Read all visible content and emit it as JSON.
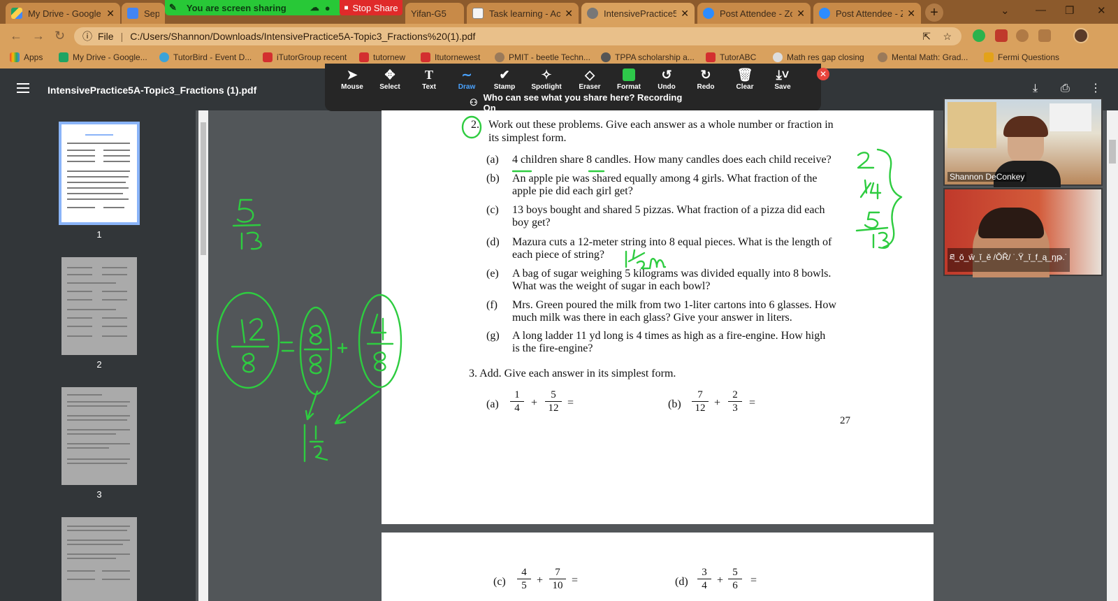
{
  "browser": {
    "tabs": [
      {
        "title": "My Drive - Google",
        "favicon": "drive-icon"
      },
      {
        "title": "Sept",
        "favicon": "docs-icon"
      },
      {
        "title": "Yifan-G5",
        "favicon": "docs-icon"
      },
      {
        "title": "Task learning - Aca",
        "favicon": "page-icon"
      },
      {
        "title": "IntensivePractice5",
        "favicon": "globe-icon"
      },
      {
        "title": "Post Attendee - Zo",
        "favicon": "zoom-icon"
      },
      {
        "title": "Post Attendee - Zo",
        "favicon": "zoom-icon"
      }
    ],
    "address": "C:/Users/Shannon/Downloads/IntensivePractice5A-Topic3_Fractions%20(1).pdf",
    "address_prefix": "File",
    "bookmarks": [
      "Apps",
      "My Drive - Google...",
      "TutorBird - Event D...",
      "iTutorGroup recent",
      "tutornew",
      "Itutornewest",
      "PMIT - beetle Techn...",
      "TPPA scholarship a...",
      "TutorABC",
      "Math res gap closing",
      "Mental Math: Grad...",
      "Fermi Questions"
    ]
  },
  "zoom": {
    "sharing_text": "You are screen sharing",
    "stop_share": "Stop Share",
    "tools": [
      "Mouse",
      "Select",
      "Text",
      "Draw",
      "Stamp",
      "Spotlight",
      "Eraser",
      "Format",
      "Undo",
      "Redo",
      "Clear",
      "Save"
    ],
    "recording_text": "Who can see what you share here? Recording On",
    "participants": [
      "Shannon DeConkey",
      "ཐ_ǒ_ŵ_ĭ_ě /ŎŘ/ ˙.Ÿ_ĭ_f_ą_ŋթ.˙"
    ]
  },
  "pdf": {
    "title": "IntensivePractice5A-Topic3_Fractions (1).pdf",
    "thumbnail_pages": [
      "1",
      "2",
      "3"
    ],
    "q2_number": "2.",
    "q2_intro_1": "Work out these problems.  Give each answer as a whole number or fraction in",
    "q2_intro_2": "its simplest form.",
    "q2_items": [
      {
        "label": "(a)",
        "lines": [
          "4 children share 8 candles. How many candles does each child receive?"
        ]
      },
      {
        "label": "(b)",
        "lines": [
          "An apple pie was shared equally among 4 girls. What fraction of the",
          "apple pie did each girl get?"
        ]
      },
      {
        "label": "(c)",
        "lines": [
          "13 boys bought and shared 5 pizzas. What fraction of a pizza did each",
          "boy get?"
        ]
      },
      {
        "label": "(d)",
        "lines": [
          "Mazura cuts a 12-meter string into 8 equal pieces. What is the length of",
          "each piece of string?"
        ]
      },
      {
        "label": "(e)",
        "lines": [
          "A bag of sugar weighing 5 kilograms was divided equally into 8 bowls.",
          "What was the weight of sugar in each bowl?"
        ]
      },
      {
        "label": "(f)",
        "lines": [
          "Mrs. Green poured the milk from two 1-liter cartons into 6 glasses. How",
          "much milk was there in each glass? Give your answer in liters."
        ]
      },
      {
        "label": "(g)",
        "lines": [
          "A long ladder 11 yd long is 4 times as high as a fire-engine. How high",
          "is the fire-engine?"
        ]
      }
    ],
    "q3_text": "3.  Add. Give each answer in its simplest form.",
    "q3_a": {
      "label": "(a)",
      "f1": [
        "1",
        "4"
      ],
      "f2": [
        "5",
        "12"
      ]
    },
    "q3_b": {
      "label": "(b)",
      "f1": [
        "7",
        "12"
      ],
      "f2": [
        "2",
        "3"
      ]
    },
    "page_number": "27",
    "q3_c": {
      "label": "(c)",
      "f1": [
        "4",
        "5"
      ],
      "f2": [
        "7",
        "10"
      ]
    },
    "q3_d": {
      "label": "(d)",
      "f1": [
        "3",
        "4"
      ],
      "f2": [
        "5",
        "6"
      ]
    },
    "plus": "+",
    "equals": "="
  }
}
